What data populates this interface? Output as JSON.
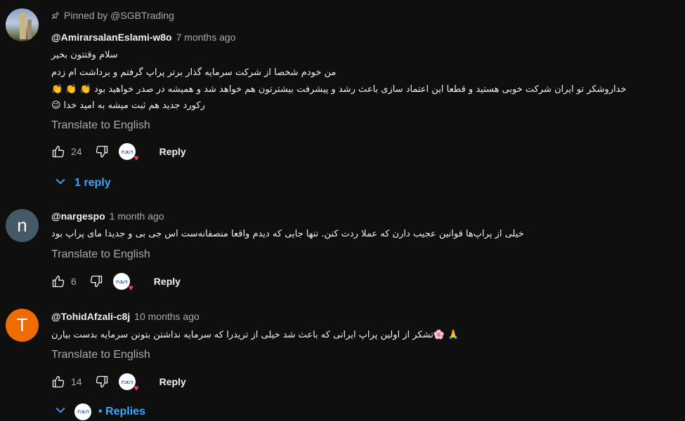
{
  "comments": [
    {
      "pinned_label": "Pinned by @SGBTrading",
      "author": "@AmirarsalanEslami-w8o",
      "time": "7 months ago",
      "lines": [
        "سلام وقتتون بخیر",
        "من خودم شخصا از شرکت سرمایه گذار برتر پراپ گرفتم و برداشت ام زدم",
        "خداروشکر تو ایران شرکت خوبی هستید و قطعا این اعتماد سازی باعث رشد و پیشرفت بیشترتون هم خواهد شد و همیشه در صدر خواهید بود 👏 👏 👏",
        "رکورد جدید هم ثبت میشه به امید خدا 😉"
      ],
      "translate": "Translate to English",
      "likes": "24",
      "reply": "Reply",
      "replies": "1 reply"
    },
    {
      "avatar_letter": "n",
      "author": "@nargespo",
      "time": "1 month ago",
      "lines": [
        "خیلی از پراپ‌ها قوانین عجیب دارن که عملا ردت کنن. تنها جایی که دیدم واقعا منصفانه‌ست اس جی بی و جدیدا مای پراپ بود"
      ],
      "translate": "Translate to English",
      "likes": "6",
      "reply": "Reply"
    },
    {
      "avatar_letter": "T",
      "author": "@TohidAfzali-c8j",
      "time": "10 months ago",
      "lines": [
        "🙏 🌸تشکر از اولین پراپ ایرانی که باعث شد خیلی از تریدرا که سرمایه نداشتن بتونن سرمایه بدست بیارن"
      ],
      "translate": "Translate to English",
      "likes": "14",
      "reply": "Reply",
      "replies": "• Replies"
    }
  ],
  "icons": {
    "pin": "pin-icon",
    "like": "thumbs-up-icon",
    "dislike": "thumbs-down-icon",
    "chevron": "chevron-down-icon",
    "creator_heart": "creator-heart-icon"
  },
  "colors": {
    "link": "#3ea6ff",
    "heart": "#ff3b57",
    "bg": "#0f0f0f"
  }
}
